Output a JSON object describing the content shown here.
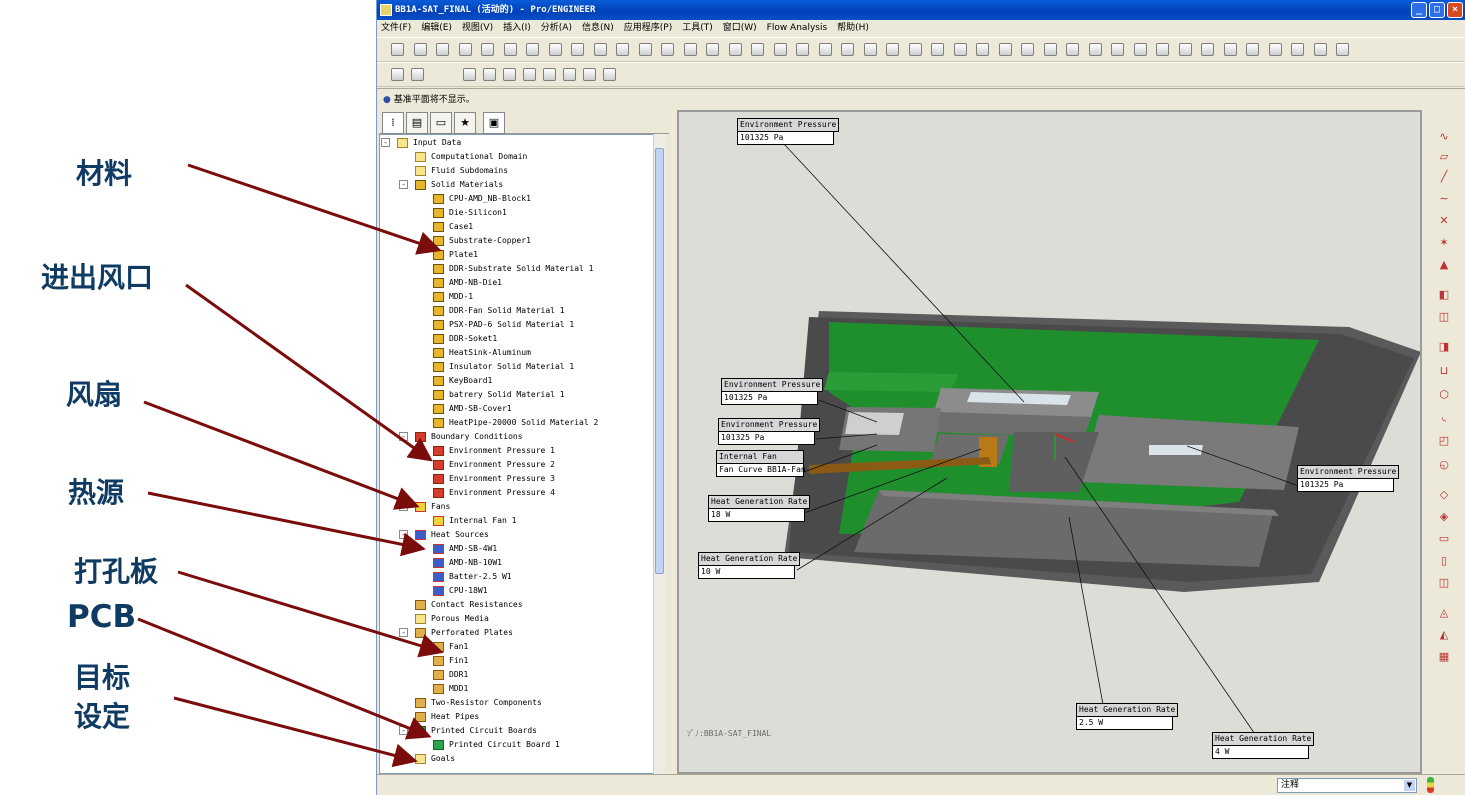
{
  "annotations": {
    "material": "材料",
    "vents": "进出风口",
    "fan": "风扇",
    "heat_source": "热源",
    "perforated_plate": "打孔板",
    "pcb": "PCB",
    "goal_line1": "目标",
    "goal_line2": "设定"
  },
  "window": {
    "title": "BB1A-SAT_FINAL (活动的) - Pro/ENGINEER"
  },
  "menu": [
    "文件(F)",
    "编辑(E)",
    "视图(V)",
    "插入(I)",
    "分析(A)",
    "信息(N)",
    "应用程序(P)",
    "工具(T)",
    "窗口(W)",
    "Flow Analysis",
    "帮助(H)"
  ],
  "message": "基准平面将不显示。",
  "tree": {
    "root": "Input Data",
    "computational_domain": "Computational Domain",
    "fluid_subdomains": "Fluid Subdomains",
    "solid_materials": "Solid Materials",
    "materials": [
      "CPU-AMD_NB-Block1",
      "Die-Silicon1",
      "Case1",
      "Substrate-Copper1",
      "Plate1",
      "DDR-Substrate Solid Material 1",
      "AMD-NB-Die1",
      "MDD-1",
      "DDR-Fan Solid Material 1",
      "PSX-PAD-6 Solid Material 1",
      "DDR-Soket1",
      "HeatSink-Aluminum",
      "Insulator Solid Material 1",
      "KeyBoard1",
      "batrery Solid Material 1",
      "AMD-SB-Cover1",
      "HeatPipe-20000 Solid Material 2"
    ],
    "boundary_conditions": "Boundary Conditions",
    "bc_items": [
      "Environment Pressure 1",
      "Environment Pressure 2",
      "Environment Pressure 3",
      "Environment Pressure 4"
    ],
    "fans": "Fans",
    "fan_items": [
      "Internal Fan 1"
    ],
    "heat_sources": "Heat Sources",
    "heat_items": [
      "AMD-SB-4W1",
      "AMD-NB-10W1",
      "Batter-2.5 W1",
      "CPU-18W1"
    ],
    "contact_resistances": "Contact Resistances",
    "porous_media": "Porous Media",
    "perforated_plates": "Perforated Plates",
    "plate_items": [
      "Fan1",
      "Fin1",
      "DDR1",
      "MDD1"
    ],
    "two_resistor": "Two-Resistor Components",
    "heat_pipes": "Heat Pipes",
    "pcbs": "Printed Circuit Boards",
    "pcb_items": [
      "Printed Circuit Board 1"
    ],
    "goals": "Goals"
  },
  "callouts": [
    {
      "title": "Environment Pressure",
      "value": "101325 Pa"
    },
    {
      "title": "Environment Pressure",
      "value": "101325 Pa"
    },
    {
      "title": "Environment Pressure",
      "value": "101325 Pa"
    },
    {
      "title": "Internal Fan",
      "value": "Fan Curve BB1A-Fan"
    },
    {
      "title": "Heat Generation Rate",
      "value": "18 W"
    },
    {
      "title": "Heat Generation Rate",
      "value": "10 W"
    },
    {
      "title": "Environment Pressure",
      "value": "101325 Pa"
    },
    {
      "title": "Heat Generation Rate",
      "value": "2.5 W"
    },
    {
      "title": "Heat Generation Rate",
      "value": "4 W"
    }
  ],
  "model_label": "ｿﾟﾉ:BB1A-SAT_FINAL",
  "status": {
    "filter": "注释"
  },
  "colors": {
    "annotation": "#0f3b63",
    "arrow": "#7a0c0c",
    "pcb_green": "#1f8f2e",
    "chassis": "#5e5e5e",
    "titlebar": "#0a5bd8"
  }
}
